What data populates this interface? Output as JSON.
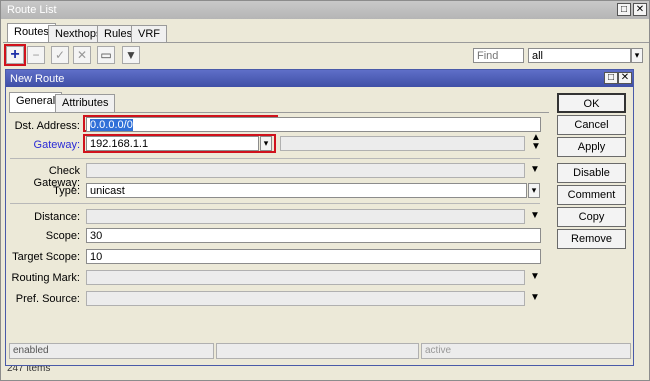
{
  "outer_window": {
    "title": "Route List",
    "tabs": [
      "Routes",
      "Nexthops",
      "Rules",
      "VRF"
    ],
    "search_placeholder": "Find",
    "filter_value": "all",
    "item_count": "247 items",
    "colors": {
      "highlight": "#d0121c",
      "add_icon": "#1d2fa8"
    }
  },
  "new_route": {
    "title": "New Route",
    "tabs": [
      "General",
      "Attributes"
    ],
    "fields": {
      "dst_address": {
        "label": "Dst. Address:",
        "value": "0.0.0.0/0"
      },
      "gateway": {
        "label": "Gateway:",
        "value": "192.168.1.1"
      },
      "check_gateway": {
        "label": "Check Gateway:",
        "value": ""
      },
      "type": {
        "label": "Type:",
        "value": "unicast"
      },
      "distance": {
        "label": "Distance:",
        "value": ""
      },
      "scope": {
        "label": "Scope:",
        "value": "30"
      },
      "target_scope": {
        "label": "Target Scope:",
        "value": "10"
      },
      "routing_mark": {
        "label": "Routing Mark:",
        "value": ""
      },
      "pref_source": {
        "label": "Pref. Source:",
        "value": ""
      }
    },
    "buttons": {
      "ok": "OK",
      "cancel": "Cancel",
      "apply": "Apply",
      "disable": "Disable",
      "comment": "Comment",
      "copy": "Copy",
      "remove": "Remove"
    },
    "status": {
      "left": "enabled",
      "right": "active"
    }
  }
}
